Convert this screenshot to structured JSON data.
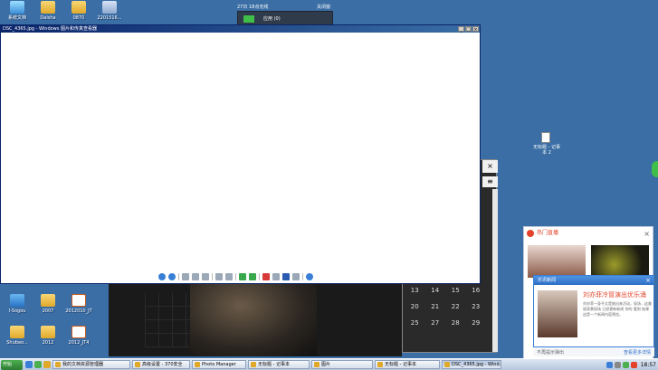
{
  "desktop": {
    "icons_top": [
      {
        "label": "系统文档",
        "kind": "app"
      },
      {
        "label": "Daisha",
        "kind": "folder"
      },
      {
        "label": "0870",
        "kind": "folder"
      },
      {
        "label": "2201516...",
        "kind": "pc"
      }
    ],
    "icons_bottom": [
      {
        "label": "I-Sogou",
        "kind": "net"
      },
      {
        "label": "2007",
        "kind": "folder"
      },
      {
        "label": "2012010_JT",
        "kind": "doc"
      },
      {
        "label": "Shubao...",
        "kind": "folder"
      },
      {
        "label": "2012",
        "kind": "folder"
      },
      {
        "label": "2012_JT4",
        "kind": "doc"
      }
    ],
    "file_icon_label": "无标题 - 记事本 2"
  },
  "top_strip": {
    "left_label": "27日 18点无线",
    "right_label": "关闭窗",
    "window_title": "应用 (0)"
  },
  "viewer": {
    "title": "DSC_4365.jpg - Windows 图片和传真查看器",
    "controls": [
      "_",
      "□",
      "×"
    ]
  },
  "side_panel": {
    "close_glyph": "×",
    "menu_glyph": "≡",
    "calendar": [
      "13",
      "14",
      "15",
      "16",
      "20",
      "21",
      "22",
      "23",
      "25",
      "27",
      "28",
      "29"
    ]
  },
  "popup_hot": {
    "title": "热门直播",
    "close": "×"
  },
  "popup_news": {
    "title": "乐讯新闻",
    "close": "×",
    "headline": "刘亦菲冷冒演出优乐涌",
    "body": "刘亦菲一身不太是她出来活动，现场…这美丽背景现场 已经更新新闻 你的 看到 结果 这是一个新闻内容预览。",
    "footer_left": "不再提示弹出",
    "footer_right": "查看更多详情"
  },
  "taskbar": {
    "start_label": "开始",
    "buttons": [
      {
        "label": "我的文档资源管理器",
        "active": false
      },
      {
        "label": "高级设置 - 370安全",
        "active": false
      },
      {
        "label": "Photo Manager",
        "active": false
      },
      {
        "label": "无标题 - 记事本",
        "active": false
      },
      {
        "label": "图片",
        "active": false
      },
      {
        "label": "无标题 - 记事本",
        "active": false
      },
      {
        "label": "DSC_4365.jpg - Wind...",
        "active": true
      }
    ],
    "clock": "18:57"
  },
  "colors": {
    "desktop": "#3a6ea5",
    "title_active": "#0a246a",
    "accent_red": "#e2432a",
    "accent_blue": "#2e6fc6"
  }
}
